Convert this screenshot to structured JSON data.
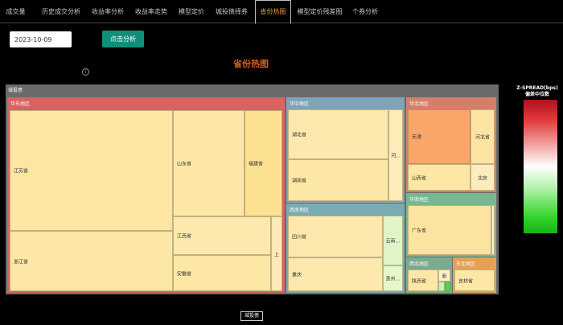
{
  "tabs": [
    {
      "label": "成交量"
    },
    {
      "label": "历史成交分析"
    },
    {
      "label": "收益率分析"
    },
    {
      "label": "收益率走势"
    },
    {
      "label": "模型定价"
    },
    {
      "label": "城投债择券"
    },
    {
      "label": "省份热图"
    },
    {
      "label": "模型定价残差图"
    },
    {
      "label": "个券分析"
    }
  ],
  "active_tab": "省份热图",
  "controls": {
    "date_value": "2023-10-09",
    "analyze_button": "点击分析"
  },
  "page_title": "省份热图",
  "info_icon": "i",
  "treemap": {
    "root_label": "城投债",
    "regions": {
      "east": {
        "label": "华东地区",
        "color": "#d96262"
      },
      "central": {
        "label": "华中地区",
        "color": "#7fa4b8"
      },
      "north": {
        "label": "华北地区",
        "color": "#d57f6a"
      },
      "south": {
        "label": "华南地区",
        "color": "#79b793"
      },
      "southwest": {
        "label": "西南地区",
        "color": "#7aaab2"
      },
      "northwest": {
        "label": "西北地区",
        "color": "#7aab8e"
      },
      "northeast": {
        "label": "东北地区",
        "color": "#e3a155"
      }
    },
    "provinces": {
      "jiangsu": "江苏省",
      "shandong": "山东省",
      "fujian": "福建省",
      "zhejiang": "浙江省",
      "jiangxi": "江西省",
      "anhui": "安徽省",
      "shanghai": "上",
      "hubei": "湖北省",
      "henan": "河...",
      "hunan": "湖南省",
      "tianjin": "天津",
      "hebei": "河北省",
      "shanxi": "山西省",
      "beijing": "北京",
      "guangdong": "广东省",
      "sichuan": "四川省",
      "yunnan": "云南...",
      "chongqing": "重庆",
      "guizhou": "贵州...",
      "shaanxi": "陕西省",
      "xinjiang": "新",
      "jilin": "吉林省"
    }
  },
  "legend": {
    "title_line1": "Z-SPREAD(bps)",
    "title_line2": "偏差中位数"
  },
  "bottom_tag": "城投债"
}
